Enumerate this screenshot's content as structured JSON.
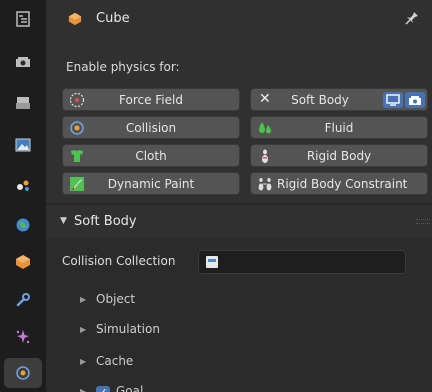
{
  "header": {
    "object_name": "Cube"
  },
  "physics": {
    "enable_label": "Enable physics for:",
    "left_buttons": [
      {
        "label": "Force Field",
        "icon": "force-field-icon"
      },
      {
        "label": "Collision",
        "icon": "collision-icon"
      },
      {
        "label": "Cloth",
        "icon": "cloth-icon"
      },
      {
        "label": "Dynamic Paint",
        "icon": "dynamic-paint-icon"
      }
    ],
    "right_buttons": [
      {
        "label": "Soft Body",
        "icon": "close-icon",
        "enabled": true
      },
      {
        "label": "Fluid",
        "icon": "fluid-icon"
      },
      {
        "label": "Rigid Body",
        "icon": "rigid-body-icon"
      },
      {
        "label": "Rigid Body Constraint",
        "icon": "rigid-body-constraint-icon"
      }
    ]
  },
  "soft_body": {
    "title": "Soft Body",
    "collision_collection_label": "Collision Collection",
    "subpanels": [
      {
        "label": "Object"
      },
      {
        "label": "Simulation"
      },
      {
        "label": "Cache"
      },
      {
        "label": "Goal",
        "checked": true
      }
    ]
  },
  "colors": {
    "accent": "#4772b3",
    "button_bg": "#545454",
    "panel_bg": "#303030"
  }
}
